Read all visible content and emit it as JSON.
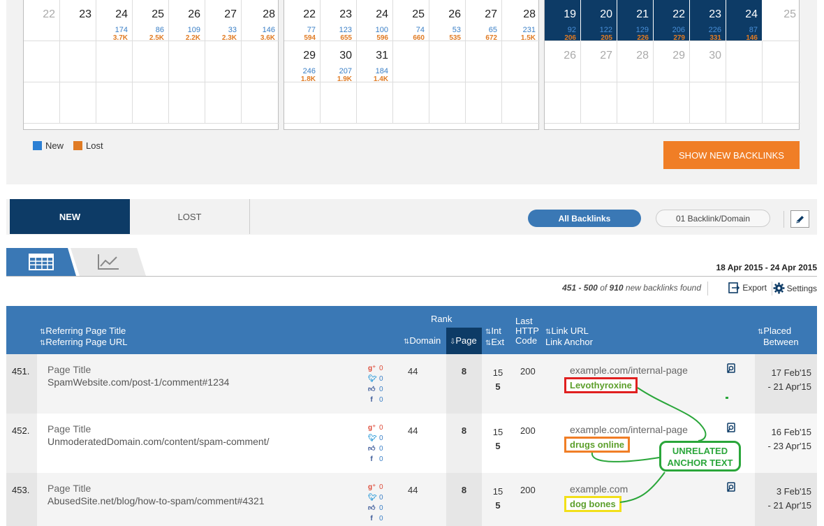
{
  "calendar": {
    "months": [
      {
        "rows": [
          [
            {
              "d": "22",
              "muted": true
            },
            {
              "d": "23"
            },
            {
              "d": "24",
              "n": "174",
              "l": "3.7K"
            },
            {
              "d": "25",
              "n": "86",
              "l": "2.5K"
            },
            {
              "d": "26",
              "n": "109",
              "l": "2.2K"
            },
            {
              "d": "27",
              "n": "33",
              "l": "2.3K"
            },
            {
              "d": "28",
              "n": "146",
              "l": "3.6K"
            }
          ],
          [
            {},
            {},
            {},
            {},
            {},
            {},
            {}
          ],
          [
            {},
            {},
            {},
            {},
            {},
            {},
            {}
          ]
        ]
      },
      {
        "rows": [
          [
            {
              "d": "22",
              "n": "77",
              "l": "594"
            },
            {
              "d": "23",
              "n": "123",
              "l": "655"
            },
            {
              "d": "24",
              "n": "100",
              "l": "596"
            },
            {
              "d": "25",
              "n": "74",
              "l": "660"
            },
            {
              "d": "26",
              "n": "53",
              "l": "535"
            },
            {
              "d": "27",
              "n": "65",
              "l": "672"
            },
            {
              "d": "28",
              "n": "231",
              "l": "1.5K"
            }
          ],
          [
            {
              "d": "29",
              "n": "246",
              "l": "1.8K"
            },
            {
              "d": "30",
              "n": "207",
              "l": "1.9K"
            },
            {
              "d": "31",
              "n": "184",
              "l": "1.4K"
            },
            {},
            {},
            {},
            {}
          ],
          [
            {},
            {},
            {},
            {},
            {},
            {},
            {}
          ]
        ]
      },
      {
        "rows": [
          [
            {
              "d": "19",
              "n": "92",
              "l": "206",
              "sel": true
            },
            {
              "d": "20",
              "n": "122",
              "l": "205",
              "sel": true
            },
            {
              "d": "21",
              "n": "129",
              "l": "226",
              "sel": true
            },
            {
              "d": "22",
              "n": "206",
              "l": "279",
              "sel": true
            },
            {
              "d": "23",
              "n": "226",
              "l": "331",
              "sel": true
            },
            {
              "d": "24",
              "n": "87",
              "l": "146",
              "sel": true
            },
            {
              "d": "25",
              "muted": true
            }
          ],
          [
            {
              "d": "26",
              "muted": true
            },
            {
              "d": "27",
              "muted": true
            },
            {
              "d": "28",
              "muted": true
            },
            {
              "d": "29",
              "muted": true
            },
            {
              "d": "30",
              "muted": true
            },
            {},
            {}
          ],
          [
            {},
            {},
            {},
            {},
            {},
            {},
            {}
          ]
        ]
      }
    ],
    "legend": {
      "new": "New",
      "lost": "Lost"
    },
    "colors": {
      "new": "#2b7fd4",
      "lost": "#e07b24",
      "selected": "#0d3b66"
    }
  },
  "show_button": "SHOW NEW BACKLINKS",
  "tabs": {
    "new": "NEW",
    "lost": "LOST"
  },
  "filters": {
    "all": "All Backlinks",
    "per_domain": "01 Backlink/Domain"
  },
  "date_range": "18 Apr 2015 - 24 Apr 2015",
  "found": {
    "range": "451 - 500",
    "of": "of",
    "total": "910",
    "suffix": "new backlinks found"
  },
  "actions": {
    "export": "Export",
    "settings": "Settings"
  },
  "table": {
    "headers": {
      "title": "Referring Page Title",
      "url": "Referring Page URL",
      "rank": "Rank",
      "domain": "Domain",
      "page": "Page",
      "int": "Int",
      "ext": "Ext",
      "http1": "Last",
      "http2": "HTTP",
      "http3": "Code",
      "link_url": "Link URL",
      "link_anchor": "Link Anchor",
      "placed1": "Placed",
      "placed2": "Between"
    },
    "rows": [
      {
        "num": "451.",
        "title": "Page Title",
        "url": "SpamWebsite.com/post-1/comment#1234",
        "gplus": "0",
        "tw": "0",
        "like": "0",
        "fb": "0",
        "domain": "44",
        "page": "8",
        "int": "15",
        "ext": "5",
        "http": "200",
        "link_url": "example.com/internal-page",
        "anchor": "Levothyroxine",
        "anchor_color": "#e02020",
        "placed1": "17 Feb'15",
        "placed2": "- 21 Apr'15"
      },
      {
        "num": "452.",
        "title": "Page Title",
        "url": "UnmoderatedDomain.com/content/spam-comment/",
        "gplus": "0",
        "tw": "0",
        "like": "0",
        "fb": "0",
        "domain": "44",
        "page": "8",
        "int": "15",
        "ext": "5",
        "http": "200",
        "link_url": "example.com/internal-page",
        "anchor": "drugs online",
        "anchor_color": "#f07e26",
        "placed1": "16 Feb'15",
        "placed2": "- 23 Apr'15"
      },
      {
        "num": "453.",
        "title": "Page Title",
        "url": "AbusedSite.net/blog/how-to-spam/comment#4321",
        "gplus": "0",
        "tw": "0",
        "like": "0",
        "fb": "0",
        "domain": "44",
        "page": "8",
        "int": "15",
        "ext": "5",
        "http": "200",
        "link_url": "example.com",
        "anchor": "dog bones",
        "anchor_color": "#f2e01a",
        "placed1": "3 Feb'15",
        "placed2": "- 21 Apr'15"
      }
    ]
  },
  "annotation": {
    "line1": "UNRELATED",
    "line2": "ANCHOR TEXT",
    "color": "#2aa63a"
  }
}
